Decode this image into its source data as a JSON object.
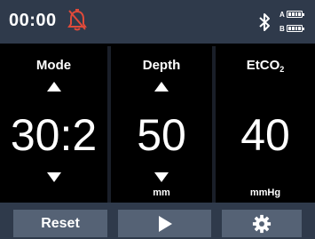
{
  "status": {
    "time": "00:00",
    "alarm_icon": "alarm-off-icon",
    "bluetooth_icon": "bluetooth-icon",
    "battery_a": {
      "label": "A",
      "level": 1.0
    },
    "battery_b": {
      "label": "B",
      "level": 1.0
    }
  },
  "columns": {
    "mode": {
      "label": "Mode",
      "value": "30:2",
      "unit": ""
    },
    "depth": {
      "label": "Depth",
      "value": "50",
      "unit": "mm"
    },
    "etco2": {
      "label_main": "EtCO",
      "label_sub": "2",
      "value": "40",
      "unit": "mmHg"
    }
  },
  "bottom": {
    "reset_label": "Reset",
    "play_icon": "play-icon",
    "settings_icon": "gear-icon"
  },
  "colors": {
    "bar_background": "#2f3a4b",
    "button_background": "#556275",
    "screen_background": "#000000",
    "foreground": "#ffffff"
  }
}
